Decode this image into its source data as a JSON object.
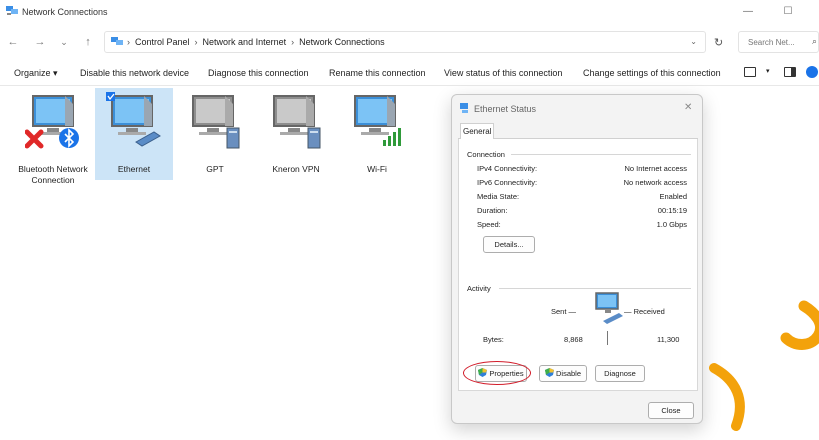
{
  "window": {
    "title": "Network Connections",
    "controls": {
      "minimize": "—",
      "maximize": "☐",
      "close": "✕"
    }
  },
  "address_bar": {
    "back": "←",
    "forward": "→",
    "recent": "⌄",
    "up": "↑",
    "breadcrumbs": [
      "Control Panel",
      "Network and Internet",
      "Network Connections"
    ],
    "separator": "›",
    "dropdown": "⌄",
    "refresh": "↻"
  },
  "search": {
    "placeholder": "Search Net...",
    "icon": "⌕"
  },
  "command_bar": {
    "items": [
      "Organize ▾",
      "Disable this network device",
      "Diagnose this connection",
      "Rename this connection",
      "View status of this connection",
      "Change settings of this connection"
    ],
    "view_caret": "▾"
  },
  "connections": [
    {
      "label": "Bluetooth Network Connection",
      "icon": "bluetooth-adapter-icon",
      "status": "disconnected",
      "selected": false
    },
    {
      "label": "Ethernet",
      "icon": "ethernet-adapter-icon",
      "status": "connected",
      "selected": true
    },
    {
      "label": "GPT",
      "icon": "vpn-adapter-icon",
      "status": "disabled",
      "selected": false
    },
    {
      "label": "Kneron VPN",
      "icon": "vpn-adapter-icon",
      "status": "disabled",
      "selected": false
    },
    {
      "label": "Wi-Fi",
      "icon": "wifi-adapter-icon",
      "status": "connected",
      "selected": false
    }
  ],
  "dialog": {
    "title": "Ethernet Status",
    "close": "✕",
    "tab": "General",
    "connection": {
      "heading": "Connection",
      "rows": [
        {
          "key": "IPv4 Connectivity:",
          "value": "No Internet access"
        },
        {
          "key": "IPv6 Connectivity:",
          "value": "No network access"
        },
        {
          "key": "Media State:",
          "value": "Enabled"
        },
        {
          "key": "Duration:",
          "value": "00:15:19"
        },
        {
          "key": "Speed:",
          "value": "1.0 Gbps"
        }
      ],
      "details_button": "Details..."
    },
    "activity": {
      "heading": "Activity",
      "sent_label": "Sent —",
      "received_label": "— Received",
      "bytes_label": "Bytes:",
      "bytes_sent": "8,868",
      "bytes_received": "11,300"
    },
    "buttons": {
      "properties": "Properties",
      "disable": "Disable",
      "diagnose": "Diagnose",
      "close": "Close"
    },
    "highlight_color": "#d21c2a"
  },
  "colors": {
    "selection": "#cce4f7",
    "accent": "#1a73e8",
    "watermark": "#f3a20b"
  }
}
